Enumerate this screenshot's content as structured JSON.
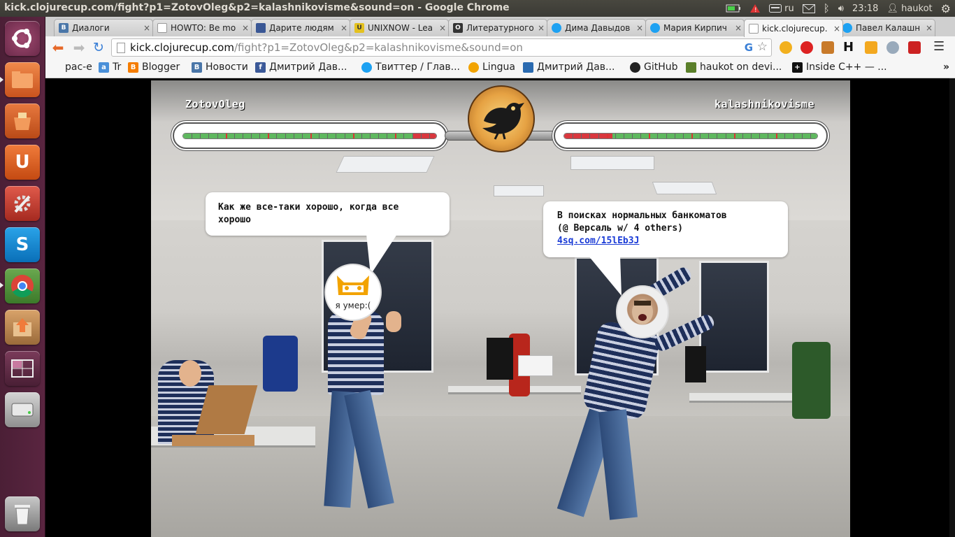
{
  "topbar": {
    "title": "kick.clojurecup.com/fight?p1=ZotovOleg&p2=kalashnikovisme&sound=on - Google Chrome",
    "keyboard": "ru",
    "time": "23:18",
    "user": "haukot"
  },
  "launcher": {
    "items": [
      {
        "name": "ubuntu-dash-icon"
      },
      {
        "name": "files-icon"
      },
      {
        "name": "software-center-icon"
      },
      {
        "name": "ubuntu-one-icon"
      },
      {
        "name": "system-settings-icon"
      },
      {
        "name": "skype-icon"
      },
      {
        "name": "chrome-icon"
      },
      {
        "name": "archive-icon"
      },
      {
        "name": "workspace-switcher-icon"
      },
      {
        "name": "drive-icon"
      },
      {
        "name": "trash-icon"
      }
    ]
  },
  "tabs": [
    {
      "label": "Диалоги",
      "color": "#4a76a8",
      "glyph": "В"
    },
    {
      "label": "HOWTO: Be mo",
      "color": "#9aa",
      "glyph": ""
    },
    {
      "label": "Дарите людям",
      "color": "#3a5795",
      "glyph": ""
    },
    {
      "label": "UNIXNOW - Lea",
      "color": "#e4c11f",
      "glyph": "U"
    },
    {
      "label": "Литературного",
      "color": "#333",
      "glyph": "O"
    },
    {
      "label": "Дима Давыдов",
      "color": "#1da1f2",
      "glyph": ""
    },
    {
      "label": "Мария Кирпич",
      "color": "#1da1f2",
      "glyph": ""
    },
    {
      "label": "kick.clojurecup.",
      "color": "#bbb",
      "glyph": ""
    },
    {
      "label": "Павел Калашн",
      "color": "#1da1f2",
      "glyph": ""
    }
  ],
  "omnibox": {
    "host": "kick.clojurecup.com",
    "rest": "/fight?p1=ZotovOleg&p2=kalashnikovisme&sound=on"
  },
  "bookmarks": [
    {
      "label": "рас-е",
      "color": ""
    },
    {
      "label": "Tr",
      "color": "#4a90d9"
    },
    {
      "label": "Blogger",
      "color": "#f57d00"
    },
    {
      "label": "Новости",
      "color": "#4a76a8"
    },
    {
      "label": "Дмитрий Дав...",
      "color": "#3b5998"
    },
    {
      "label": "Твиттер / Глав...",
      "color": "#1da1f2"
    },
    {
      "label": "Lingua",
      "color": "#f2a300"
    },
    {
      "label": "Дмитрий Дав...",
      "color": "#2a6ab0"
    },
    {
      "label": "GitHub",
      "color": "#222"
    },
    {
      "label": "haukot on devi...",
      "color": "#5a7f2a"
    },
    {
      "label": "Inside C++ — ...",
      "color": "#111"
    }
  ],
  "game": {
    "player1": {
      "name": "ZotovOleg",
      "health": 0.9,
      "speech": "Как же все-таки хорошо, когда все хорошо",
      "avatar_text": "я умер:("
    },
    "player2": {
      "name": "kalashnikovisme",
      "health": 0.81,
      "speech_line1": "В поисках нормальных банкоматов",
      "speech_line2": "(@ Версаль w/ 4 others)",
      "speech_link": "4sq.com/15lEb3J"
    }
  }
}
